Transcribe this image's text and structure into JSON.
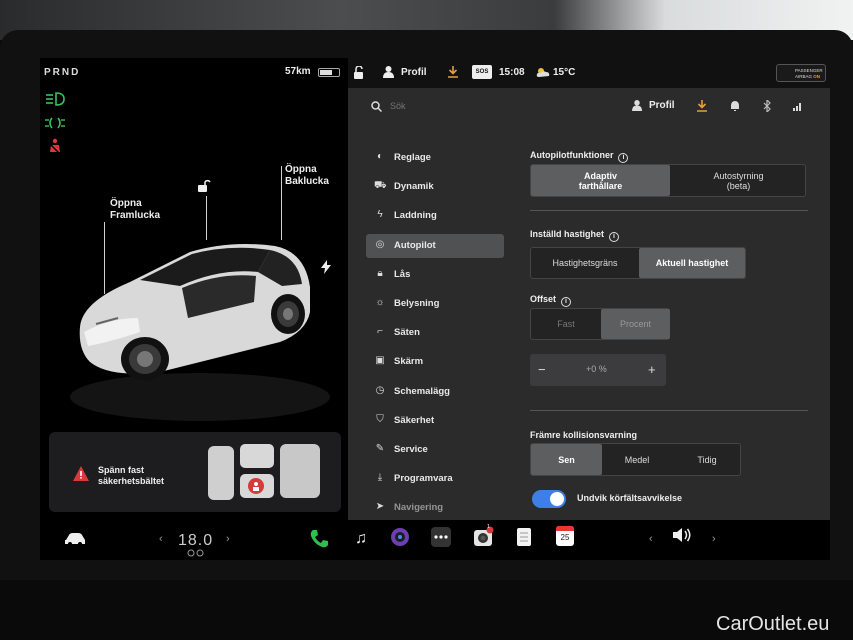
{
  "status": {
    "gear": "PRND",
    "range": "57km",
    "profile": "Profil",
    "sos": "SOS",
    "time": "15:08",
    "temperature": "15°C",
    "airbag_line1": "PASSENGER",
    "airbag_line2": "AIRBAG ",
    "airbag_state": "ON"
  },
  "car": {
    "front_trunk_line1": "Öppna",
    "front_trunk_line2": "Framlucka",
    "rear_trunk_line1": "Öppna",
    "rear_trunk_line2": "Baklucka"
  },
  "alert": {
    "line1": "Spänn fast",
    "line2": "säkerhetsbältet"
  },
  "search": {
    "placeholder": "Sök"
  },
  "header": {
    "profile": "Profil"
  },
  "menu": [
    {
      "label": "Reglage",
      "icon": "toggle-icon"
    },
    {
      "label": "Dynamik",
      "icon": "car-icon"
    },
    {
      "label": "Laddning",
      "icon": "bolt-icon"
    },
    {
      "label": "Autopilot",
      "icon": "steering-wheel-icon",
      "active": true
    },
    {
      "label": "Lås",
      "icon": "lock-icon"
    },
    {
      "label": "Belysning",
      "icon": "sun-icon"
    },
    {
      "label": "Säten",
      "icon": "seat-icon"
    },
    {
      "label": "Skärm",
      "icon": "display-icon"
    },
    {
      "label": "Schemalägg",
      "icon": "clock-icon"
    },
    {
      "label": "Säkerhet",
      "icon": "shield-icon"
    },
    {
      "label": "Service",
      "icon": "wrench-icon"
    },
    {
      "label": "Programvara",
      "icon": "download-icon"
    },
    {
      "label": "Navigering",
      "icon": "navigation-icon"
    }
  ],
  "autopilot": {
    "features_title": "Autopilotfunktioner",
    "features_opt1_l1": "Adaptiv",
    "features_opt1_l2": "farthållare",
    "features_opt2_l1": "Autostyrning",
    "features_opt2_l2": "(beta)",
    "speed_title": "Inställd hastighet",
    "speed_opt1": "Hastighetsgräns",
    "speed_opt2": "Aktuell hastighet",
    "offset_title": "Offset",
    "offset_opt1": "Fast",
    "offset_opt2": "Procent",
    "offset_minus": "−",
    "offset_value": "+0 %",
    "offset_plus": "+",
    "fcw_title": "Främre kollisionsvarning",
    "fcw_opt1": "Sen",
    "fcw_opt2": "Medel",
    "fcw_opt3": "Tidig",
    "lane_label": "Undvik körfältsavvikelse",
    "lane_enabled": true
  },
  "dock": {
    "temperature": "18.0",
    "calendar_day": "25",
    "camera_badge": "1"
  },
  "watermark": "CarOutlet.eu",
  "colors": {
    "toggle_on": "#3d7fe6",
    "warning_red": "#d63a3a",
    "telltale_green": "#35c25a",
    "download_orange": "#e8a03a"
  }
}
